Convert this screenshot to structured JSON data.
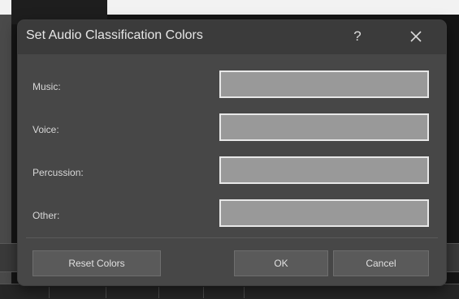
{
  "dialog": {
    "title": "Set Audio Classification Colors",
    "help_label": "?",
    "close_icon": "close-icon"
  },
  "rows": [
    {
      "label": "Music:",
      "color": "#999999"
    },
    {
      "label": "Voice:",
      "color": "#999999"
    },
    {
      "label": "Percussion:",
      "color": "#999999"
    },
    {
      "label": "Other:",
      "color": "#999999"
    }
  ],
  "buttons": {
    "reset": "Reset Colors",
    "ok": "OK",
    "cancel": "Cancel"
  },
  "colors": {
    "dialog_bg": "#474747",
    "titlebar_bg": "#3b3b3b",
    "swatch_border": "#e8e8e8",
    "button_bg": "#5a5a5a"
  }
}
